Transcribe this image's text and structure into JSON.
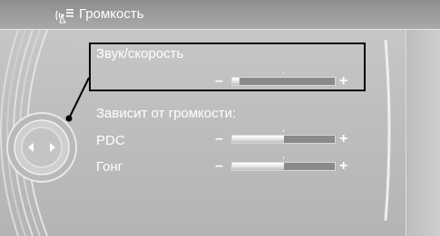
{
  "header": {
    "title": "Громкость",
    "icon": "speaker-settings-icon"
  },
  "settings": [
    {
      "label": "Звук/скорость",
      "minus": "–",
      "plus": "+",
      "value_fraction": 0.07,
      "selected": true
    },
    {
      "label": "PDC",
      "minus": "–",
      "plus": "+",
      "value_fraction": 0.5,
      "selected": false
    },
    {
      "label": "Гонг",
      "minus": "–",
      "plus": "+",
      "value_fraction": 0.5,
      "selected": false
    }
  ],
  "section_label": "Зависит от громкости:",
  "controller": {
    "icon": "controller-knob-icon"
  },
  "colors": {
    "text": "#ffffff",
    "background": "#c2c2c2",
    "selection": "#000000"
  }
}
